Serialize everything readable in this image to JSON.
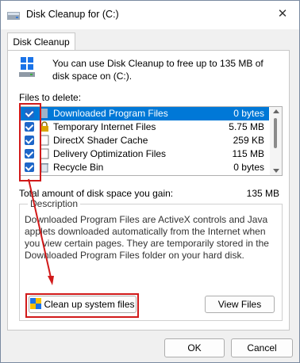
{
  "window": {
    "title": "Disk Cleanup for  (C:)",
    "close_glyph": "✕"
  },
  "tab": {
    "label": "Disk Cleanup"
  },
  "intro": {
    "text": "You can use Disk Cleanup to free up to 135 MB of disk space on  (C:)."
  },
  "files": {
    "label": "Files to delete:",
    "items": [
      {
        "name": "Downloaded Program Files",
        "size": "0 bytes",
        "checked": true,
        "selected": true,
        "icon": "folder-icon"
      },
      {
        "name": "Temporary Internet Files",
        "size": "5.75 MB",
        "checked": true,
        "selected": false,
        "icon": "lock-icon"
      },
      {
        "name": "DirectX Shader Cache",
        "size": "259 KB",
        "checked": true,
        "selected": false,
        "icon": "file-icon"
      },
      {
        "name": "Delivery Optimization Files",
        "size": "115 MB",
        "checked": true,
        "selected": false,
        "icon": "file-icon"
      },
      {
        "name": "Recycle Bin",
        "size": "0 bytes",
        "checked": true,
        "selected": false,
        "icon": "recycle-bin-icon"
      }
    ]
  },
  "total": {
    "label": "Total amount of disk space you gain:",
    "value": "135 MB"
  },
  "description": {
    "title": "Description",
    "text": "Downloaded Program Files are ActiveX controls and Java applets downloaded automatically from the Internet when you view certain pages. They are temporarily stored in the Downloaded Program Files folder on your hard disk."
  },
  "buttons": {
    "cleanup": "Clean up system files",
    "view": "View Files",
    "ok": "OK",
    "cancel": "Cancel"
  },
  "colors": {
    "selection": "#0078d7",
    "checkbox": "#1e66c8",
    "annotation": "#d11a1a"
  }
}
